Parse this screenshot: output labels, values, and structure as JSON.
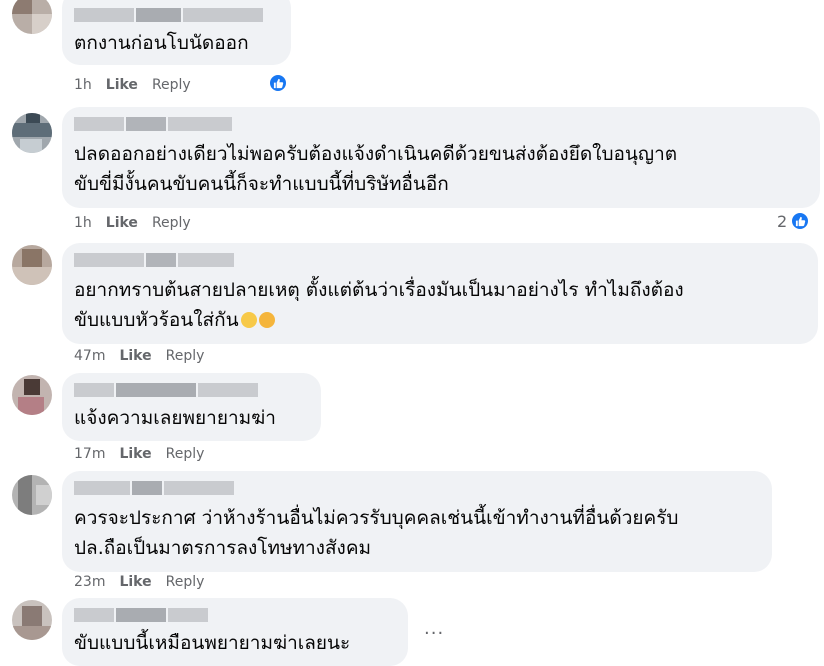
{
  "comments": [
    {
      "text_lines": [
        "ตกงานก่อนโบนัดออก"
      ],
      "time": "1h",
      "like": "Like",
      "reply": "Reply",
      "reaction_count": ""
    },
    {
      "text_lines": [
        "ปลดออกอย่างเดียวไม่พอครับต้องแจ้งดำเนินคดีด้วยขนส่งต้องยึดใบอนุญาต",
        "ขับขี่มีงั้นคนขับคนนี้ก็จะทำแบบนี้ที่บริษัทอื่นอีก"
      ],
      "time": "1h",
      "like": "Like",
      "reply": "Reply",
      "reaction_count": "2"
    },
    {
      "text_lines": [
        "อยากทราบต้นสายปลายเหตุ ตั้งแต่ต้นว่าเรื่องมันเป็นมาอย่างไร ทำไมถึงต้อง",
        "ขับแบบหัวร้อนใส่กัน"
      ],
      "time": "47m",
      "like": "Like",
      "reply": "Reply",
      "reaction_count": ""
    },
    {
      "text_lines": [
        "แจ้งความเลยพยายามฆ่า"
      ],
      "time": "17m",
      "like": "Like",
      "reply": "Reply",
      "reaction_count": ""
    },
    {
      "text_lines": [
        "ควรจะประกาศ ว่าห้างร้านอื่นไม่ควรรับบุคคลเช่นนี้เข้าทำงานที่อื่นด้วยครับ",
        "ปล.ถือเป็นมาตรการลงโทษทางสังคม"
      ],
      "time": "23m",
      "like": "Like",
      "reply": "Reply",
      "reaction_count": ""
    },
    {
      "text_lines": [
        "ขับแบบนี้เหมือนพยายามฆ่าเลยนะ"
      ],
      "time": "",
      "like": "",
      "reply": "",
      "reaction_count": ""
    }
  ],
  "more_options": "...",
  "emojis": [
    "crying-face",
    "worried-face"
  ],
  "colors": {
    "bubble": "#f0f2f5",
    "like_blue": "#1877f2",
    "meta_gray": "#65676b"
  }
}
